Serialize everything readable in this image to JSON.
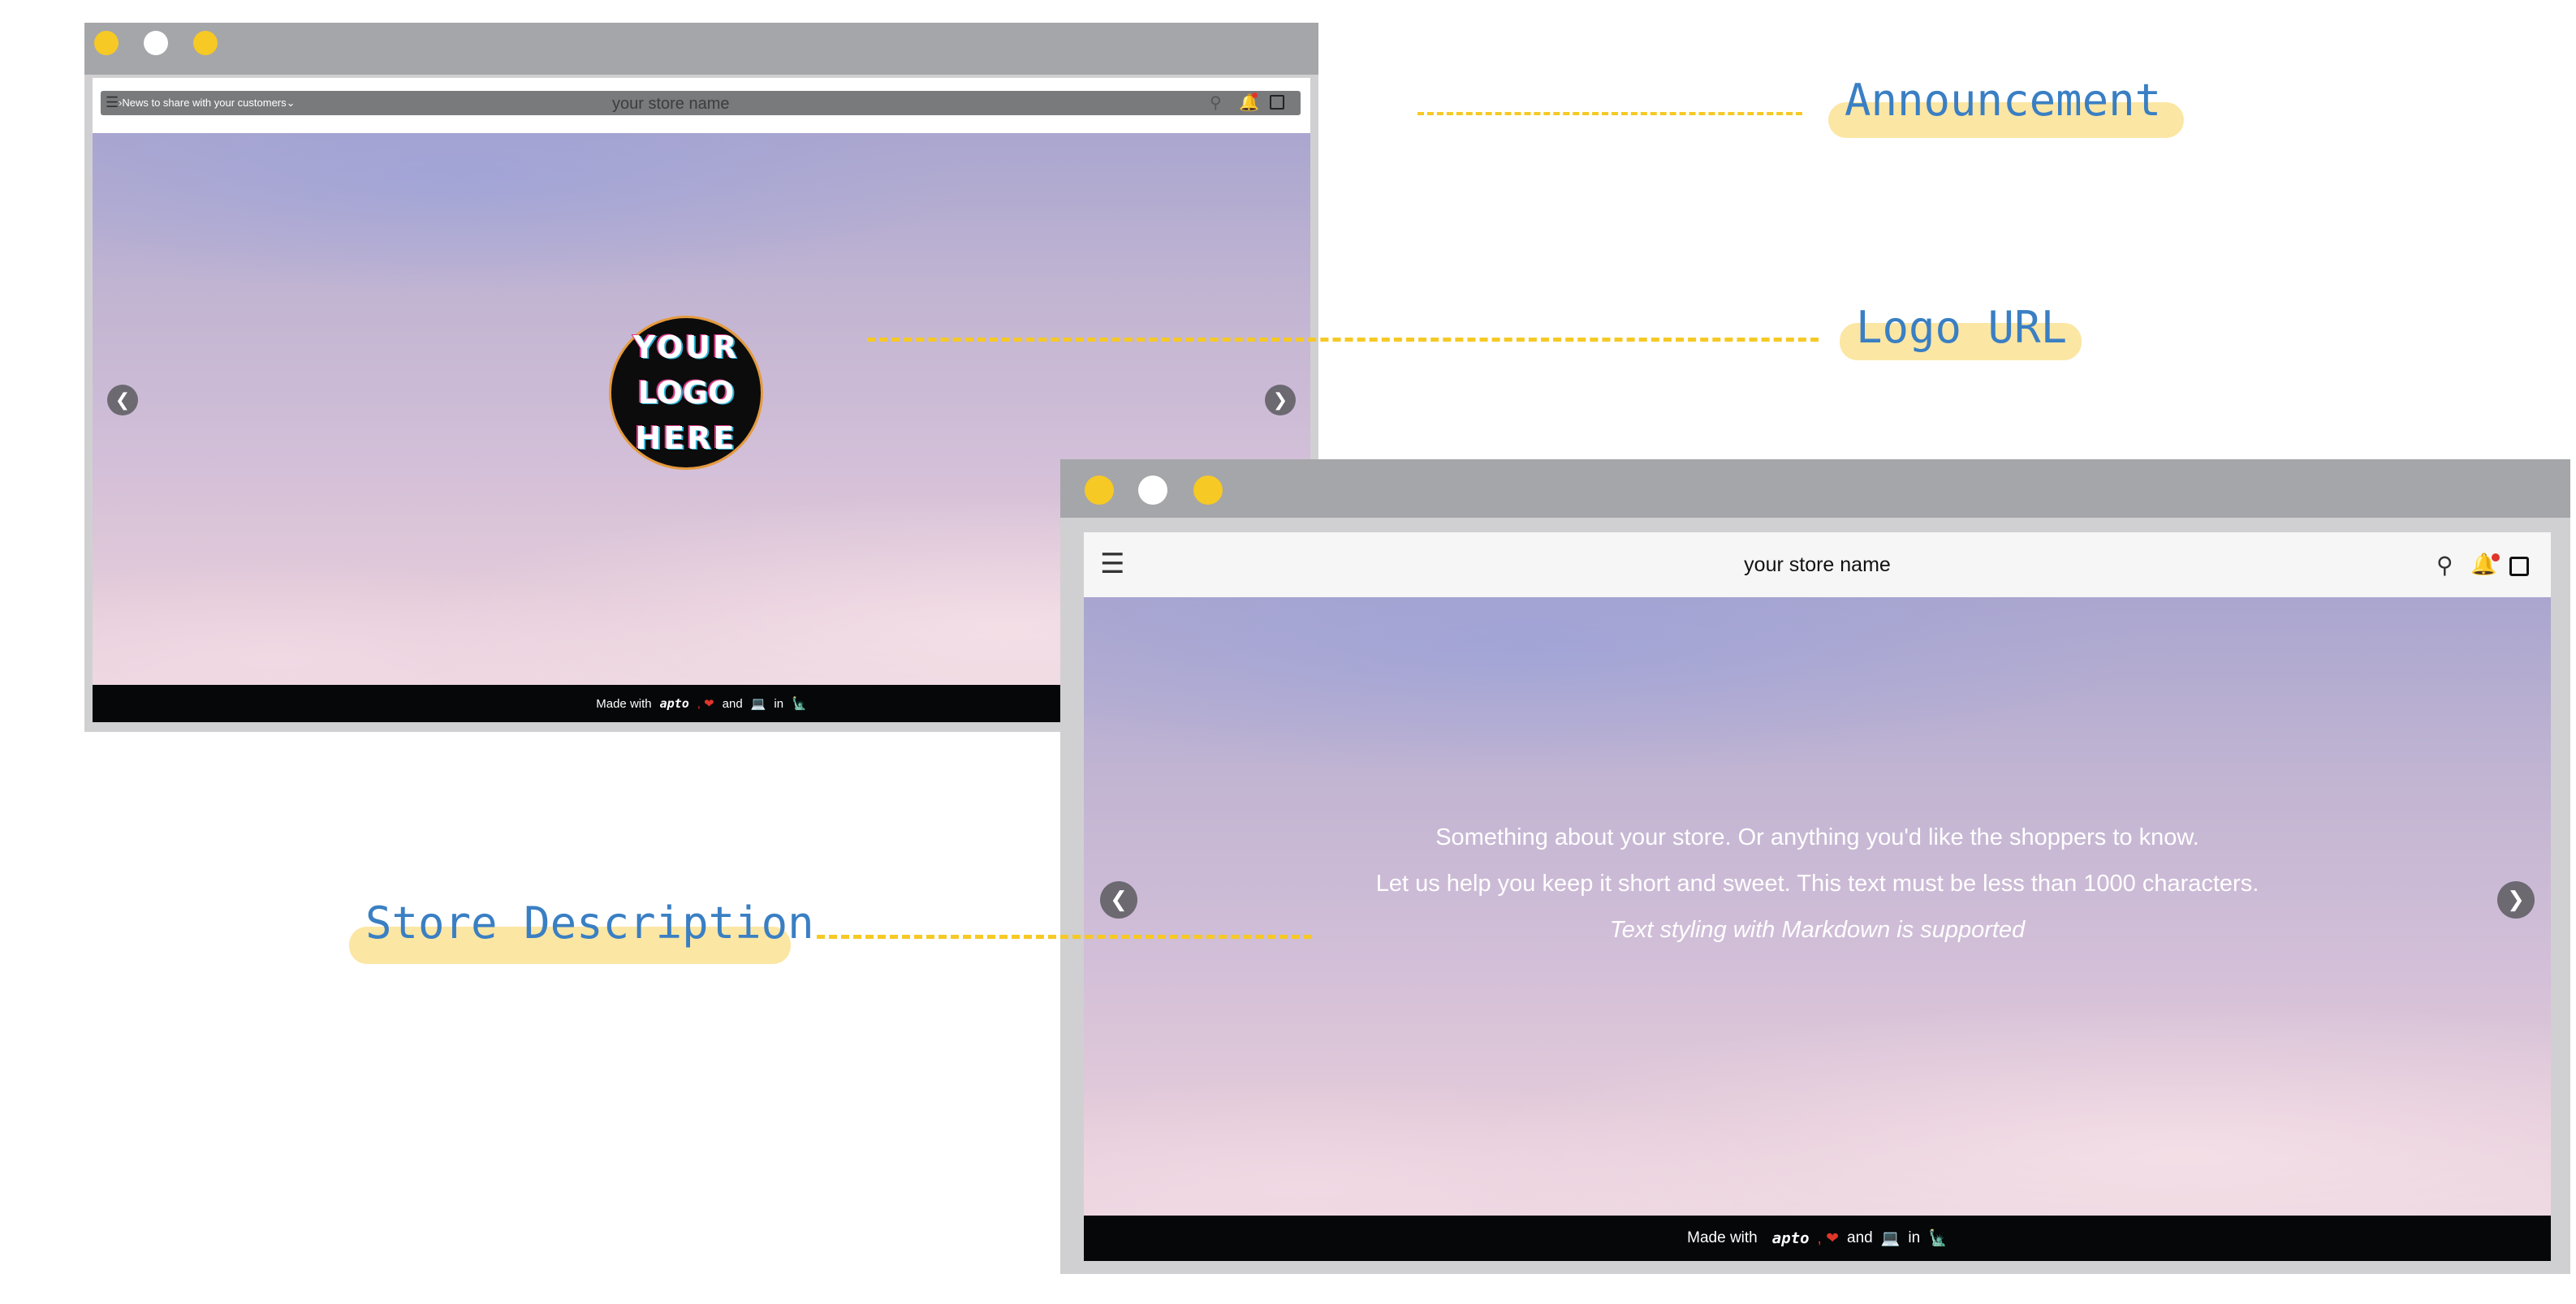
{
  "annotations": {
    "announcement": "Announcement",
    "logo_url": "Logo URL",
    "store_description": "Store Description"
  },
  "window_back": {
    "announcement_text": "News to share with your customers",
    "store_name": "your store name",
    "logo_lines": [
      "YOUR",
      "LOGO",
      "HERE"
    ],
    "footer": {
      "made_with": "Made with",
      "brand": "aptо",
      "and": "and",
      "in": "in"
    }
  },
  "window_front": {
    "store_name": "your store name",
    "description": {
      "line1": "Something about your store. Or anything you'd like the shoppers to know.",
      "line2": "Let us help you keep it short and sweet. This text must be less than 1000 characters.",
      "line3": "Text styling with Markdown is supported"
    },
    "footer": {
      "made_with": "Made with",
      "brand": "aptо",
      "and": "and",
      "in": "in"
    }
  },
  "icons": {
    "menu": "menu-icon",
    "search": "search-icon",
    "bell": "bell-icon",
    "bag": "shopping-bag-icon",
    "heart": "heart-emoji",
    "computer": "computer-emoji",
    "liberty": "statue-of-liberty-emoji",
    "prev": "chevron-left-icon",
    "next": "chevron-right-icon"
  },
  "colors": {
    "accent_yellow": "#f6c924",
    "label_blue": "#3a7fc3",
    "highlight": "#fbe6a4",
    "titlebar": "#a5a6a9",
    "footer": "#050708",
    "notification_dot": "#e0352b"
  }
}
